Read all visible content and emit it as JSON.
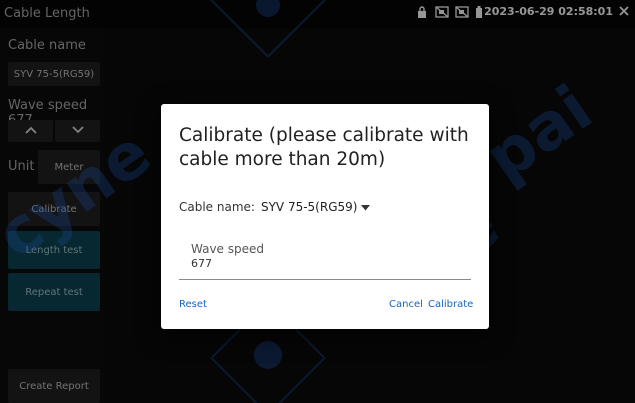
{
  "statusbar": {
    "title": "Cable Length",
    "datetime": "2023-06-29 02:58:01",
    "icons": [
      "lock-icon",
      "no-signal-icon",
      "no-signal-icon",
      "battery-icon",
      "close-icon"
    ]
  },
  "sidebar": {
    "cable_name_label": "Cable name",
    "cable_name_value": "SYV 75-5(RG59)",
    "wave_speed_label": "Wave speed 677",
    "unit_label": "Unit",
    "unit_value": "Meter",
    "calibrate_label": "Calibrate",
    "length_test_label": "Length test",
    "repeat_test_label": "Repeat test",
    "create_report_label": "Create Report"
  },
  "dialog": {
    "title": "Calibrate (please calibrate with cable more than 20m)",
    "cable_label": "Cable name:",
    "cable_value": "SYV 75-5(RG59)",
    "wave_label": "Wave speed",
    "wave_value": "677",
    "reset_label": "Reset",
    "cancel_label": "Cancel",
    "calibrate_label": "Calibrate"
  },
  "colors": {
    "teal_button": "#0d3e4c",
    "dark_button": "#1e1e1e",
    "link_blue": "#1565c0",
    "watermark": "#1a4fa0"
  }
}
